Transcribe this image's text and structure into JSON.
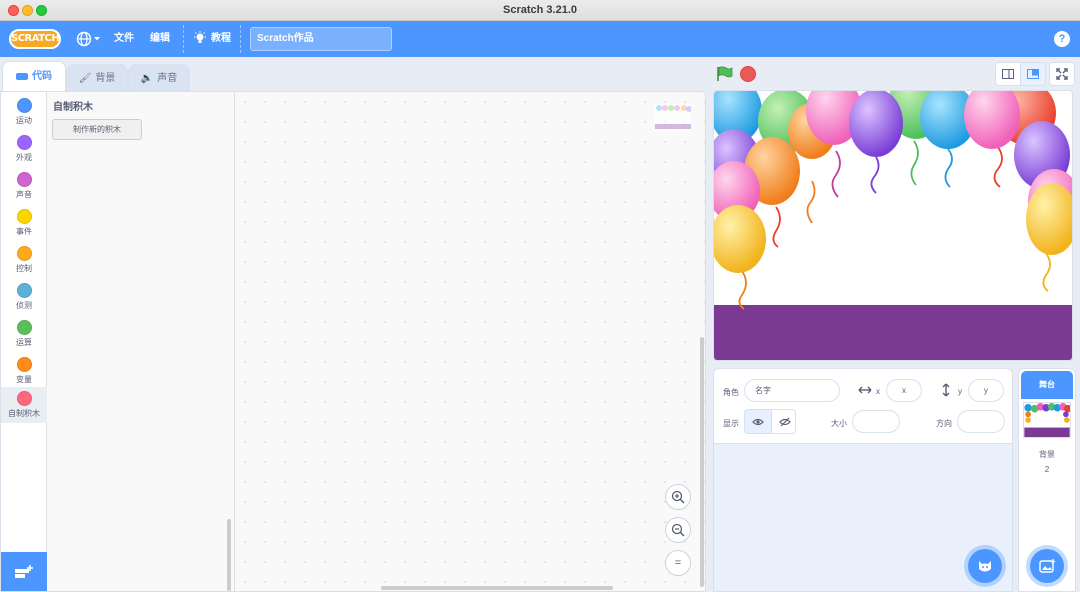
{
  "window": {
    "title": "Scratch 3.21.0"
  },
  "menubar": {
    "logo": "SCRATCH",
    "file": "文件",
    "edit": "编辑",
    "tutorials": "教程",
    "project_title": "Scratch作品",
    "help": "?"
  },
  "tabs": {
    "code": "代码",
    "backdrops": "背景",
    "sounds": "声音"
  },
  "categories": [
    {
      "label": "运动",
      "color": "#4c97ff"
    },
    {
      "label": "外观",
      "color": "#9966ff"
    },
    {
      "label": "声音",
      "color": "#cf63cf"
    },
    {
      "label": "事件",
      "color": "#ffd500"
    },
    {
      "label": "控制",
      "color": "#ffab19"
    },
    {
      "label": "侦测",
      "color": "#5cb1d6"
    },
    {
      "label": "运算",
      "color": "#59c059"
    },
    {
      "label": "变量",
      "color": "#ff8c1a"
    },
    {
      "label": "自制积木",
      "color": "#ff6680"
    }
  ],
  "flyout": {
    "title": "自制积木",
    "make_block": "制作新的积木"
  },
  "zoom": {
    "in": "+",
    "out": "−",
    "reset": "="
  },
  "sprite_info": {
    "sprite_label": "角色",
    "name_placeholder": "名字",
    "x_label": "x",
    "x_placeholder": "x",
    "y_label": "y",
    "y_placeholder": "y",
    "show_label": "显示",
    "size_label": "大小",
    "direction_label": "方向"
  },
  "stage_pane": {
    "title": "舞台",
    "backdrops_label": "背景",
    "backdrop_count": "2"
  },
  "colors": {
    "accent": "#4c97ff",
    "stage_floor": "#7a3a92"
  }
}
